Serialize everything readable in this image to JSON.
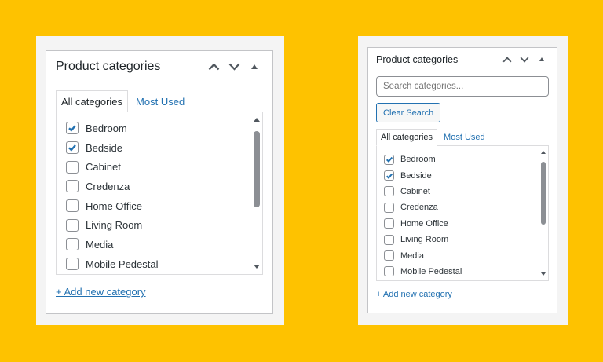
{
  "left_box": {
    "title": "Product categories",
    "tabs": [
      "All categories",
      "Most Used"
    ],
    "categories": [
      {
        "label": "Bedroom",
        "checked": true
      },
      {
        "label": "Bedside",
        "checked": true
      },
      {
        "label": "Cabinet",
        "checked": false
      },
      {
        "label": "Credenza",
        "checked": false
      },
      {
        "label": "Home Office",
        "checked": false
      },
      {
        "label": "Living Room",
        "checked": false
      },
      {
        "label": "Media",
        "checked": false
      },
      {
        "label": "Mobile Pedestal",
        "checked": false
      }
    ],
    "add_link": "+ Add new category"
  },
  "right_box": {
    "title": "Product categories",
    "search_placeholder": "Search categories...",
    "clear_button": "Clear Search",
    "tabs": [
      "All categories",
      "Most Used"
    ],
    "categories": [
      {
        "label": "Bedroom",
        "checked": true
      },
      {
        "label": "Bedside",
        "checked": true
      },
      {
        "label": "Cabinet",
        "checked": false
      },
      {
        "label": "Credenza",
        "checked": false
      },
      {
        "label": "Home Office",
        "checked": false
      },
      {
        "label": "Living Room",
        "checked": false
      },
      {
        "label": "Media",
        "checked": false
      },
      {
        "label": "Mobile Pedestal",
        "checked": false
      }
    ],
    "add_link": "+ Add new category"
  },
  "colors": {
    "background": "#fec200",
    "link": "#2271b1",
    "text": "#1d2327",
    "border": "#c3c4c7"
  },
  "icons": [
    "chevron-up-icon",
    "chevron-down-icon",
    "toggle-arrow-icon",
    "check-icon",
    "scroll-up-icon",
    "scroll-down-icon"
  ]
}
